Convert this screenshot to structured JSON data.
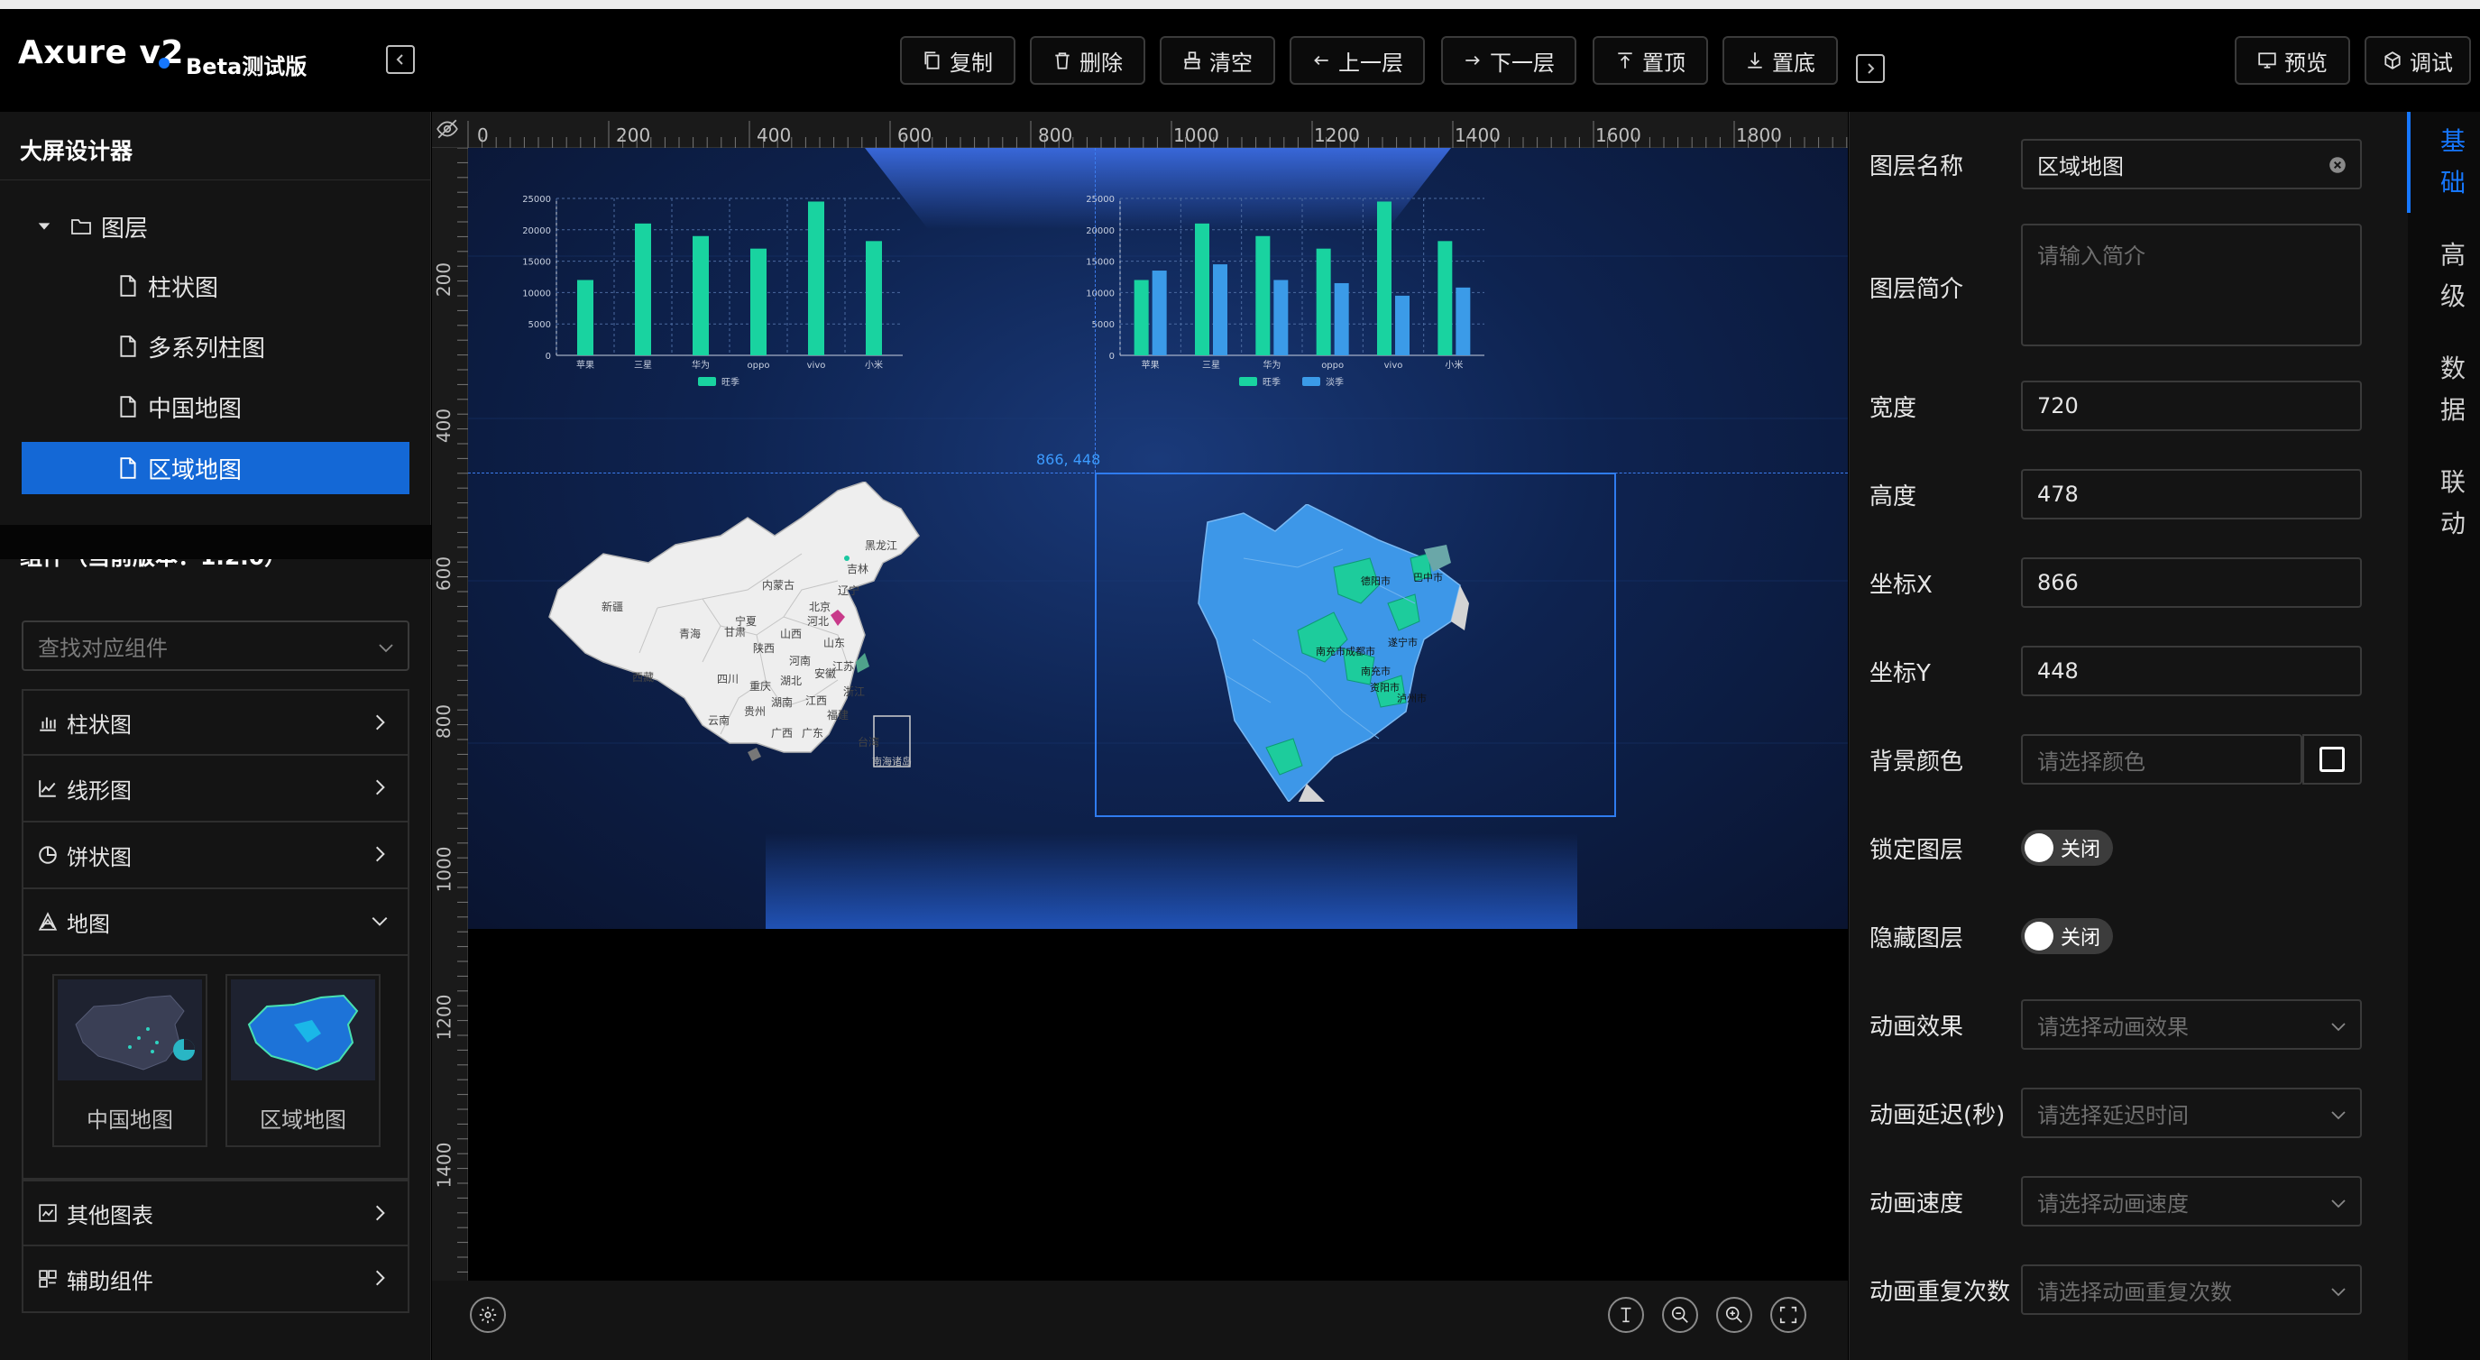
{
  "app": {
    "name": "Axure v2",
    "beta": "Beta测试版"
  },
  "toolbar": {
    "copy": "复制",
    "delete": "删除",
    "clear": "清空",
    "layer_up": "上一层",
    "layer_down": "下一层",
    "to_top": "置顶",
    "to_bottom": "置底",
    "preview": "预览",
    "debug": "调试"
  },
  "left_panel": {
    "title": "大屏设计器",
    "layers_root": "图层",
    "layers": [
      "柱状图",
      "多系列柱图",
      "中国地图",
      "区域地图"
    ],
    "selected_layer": "区域地图",
    "components_title": "组件（当前版本：1.2.0）",
    "search_placeholder": "查找对应组件",
    "categories": [
      "柱状图",
      "线形图",
      "饼状图",
      "地图",
      "其他图表",
      "辅助组件"
    ],
    "map_items": [
      "中国地图",
      "区域地图"
    ]
  },
  "canvas": {
    "ruler_top": [
      "0",
      "200",
      "400",
      "600",
      "800",
      "1000",
      "1200",
      "1400",
      "1600",
      "1800"
    ],
    "ruler_left": [
      "200",
      "400",
      "600",
      "800",
      "1000",
      "1200",
      "1400"
    ],
    "coord_label": "866, 448",
    "region_labels": [
      "德阳市",
      "巴中市",
      "南充市",
      "遂宁市",
      "资阳市",
      "泸州市",
      "南充市成都市"
    ],
    "china_labels": [
      "新疆",
      "西藏",
      "青海",
      "甘肃",
      "内蒙古",
      "四川",
      "云南",
      "黑龙江",
      "吉林",
      "辽宁",
      "宁夏",
      "陕西",
      "山西",
      "河北",
      "河南",
      "湖北",
      "湖南",
      "贵州",
      "重庆",
      "广西",
      "广东",
      "安徽",
      "江西",
      "福建",
      "浙江",
      "江苏",
      "山东",
      "北京",
      "台湾",
      "南海诸岛"
    ]
  },
  "chart_data": [
    {
      "type": "bar",
      "categories": [
        "苹果",
        "三星",
        "华为",
        "oppo",
        "vivo",
        "小米"
      ],
      "series": [
        {
          "name": "旺季",
          "values": [
            12000,
            21000,
            19000,
            17000,
            24500,
            18200
          ]
        }
      ],
      "yticks": [
        "0",
        "5000",
        "10000",
        "15000",
        "20000",
        "25000"
      ],
      "ylim": [
        0,
        25000
      ],
      "colors": [
        "#19d3a0"
      ]
    },
    {
      "type": "bar",
      "categories": [
        "苹果",
        "三星",
        "华为",
        "oppo",
        "vivo",
        "小米"
      ],
      "series": [
        {
          "name": "旺季",
          "values": [
            12000,
            21000,
            19000,
            17000,
            24500,
            18200
          ]
        },
        {
          "name": "淡季",
          "values": [
            13500,
            14500,
            12000,
            11500,
            9500,
            10800
          ]
        }
      ],
      "yticks": [
        "0",
        "5000",
        "10000",
        "15000",
        "20000",
        "25000"
      ],
      "ylim": [
        0,
        25000
      ],
      "colors": [
        "#19d3a0",
        "#3b9be8"
      ]
    }
  ],
  "properties": {
    "layer_name_label": "图层名称",
    "layer_name": "区域地图",
    "layer_desc_label": "图层简介",
    "layer_desc_placeholder": "请输入简介",
    "width_label": "宽度",
    "width": "720",
    "height_label": "高度",
    "height": "478",
    "x_label": "坐标X",
    "x": "866",
    "y_label": "坐标Y",
    "y": "448",
    "bg_label": "背景颜色",
    "bg_placeholder": "请选择颜色",
    "lock_label": "锁定图层",
    "lock_value": "关闭",
    "hide_label": "隐藏图层",
    "hide_value": "关闭",
    "anim_label": "动画效果",
    "anim_placeholder": "请选择动画效果",
    "delay_label": "动画延迟(秒)",
    "delay_placeholder": "请选择延迟时间",
    "speed_label": "动画速度",
    "speed_placeholder": "请选择动画速度",
    "repeat_label": "动画重复次数",
    "repeat_placeholder": "请选择动画重复次数"
  },
  "right_tabs": [
    [
      "基",
      "础"
    ],
    [
      "高",
      "级"
    ],
    [
      "数",
      "据"
    ],
    [
      "联",
      "动"
    ]
  ]
}
